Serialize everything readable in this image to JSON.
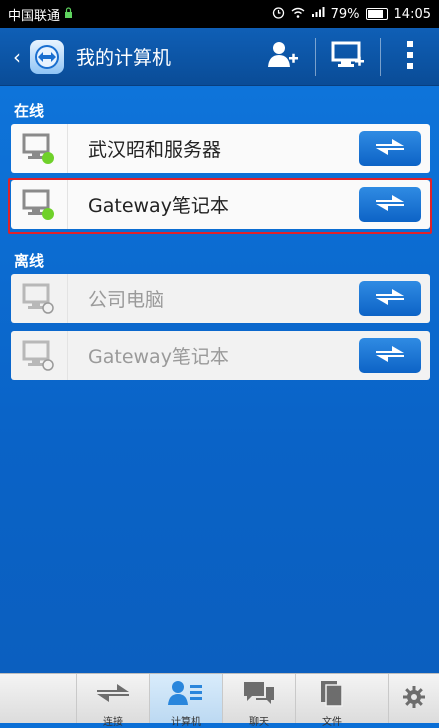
{
  "status_bar": {
    "carrier": "中国联通",
    "battery": "79%",
    "time": "14:05"
  },
  "app_bar": {
    "title": "我的计算机"
  },
  "sections": {
    "online_label": "在线",
    "offline_label": "离线"
  },
  "computers": {
    "online": [
      {
        "name": "武汉昭和服务器",
        "status": "online"
      },
      {
        "name": "Gateway笔记本",
        "status": "online"
      }
    ],
    "offline": [
      {
        "name": "公司电脑",
        "status": "offline"
      },
      {
        "name": "Gateway笔记本",
        "status": "offline"
      }
    ]
  },
  "tabs": [
    {
      "label": "连接",
      "icon": "connect-arrows-icon"
    },
    {
      "label": "计算机",
      "icon": "contacts-icon",
      "active": true
    },
    {
      "label": "聊天",
      "icon": "chat-icon"
    },
    {
      "label": "文件",
      "icon": "files-icon"
    }
  ],
  "colors": {
    "app_bar": "#0a4c97",
    "background": "#0b6fd6",
    "online_dot": "#6fd12a",
    "connect_button": "#1a74d6",
    "highlight": "#e0222a"
  }
}
